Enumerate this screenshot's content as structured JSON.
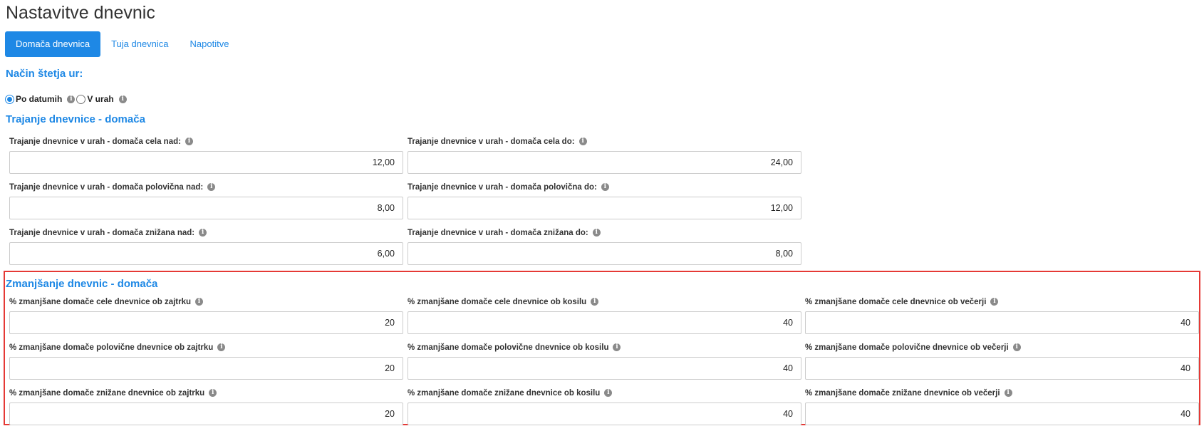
{
  "page_title": "Nastavitve dnevnic",
  "tabs": [
    {
      "label": "Domača dnevnica",
      "active": true
    },
    {
      "label": "Tuja dnevnica",
      "active": false
    },
    {
      "label": "Napotitve",
      "active": false
    }
  ],
  "counting": {
    "title": "Način štetja ur:",
    "options": [
      {
        "label": "Po datumih",
        "checked": true
      },
      {
        "label": "V urah",
        "checked": false
      }
    ]
  },
  "duration": {
    "title": "Trajanje dnevnice - domača",
    "fields": [
      {
        "label": "Trajanje dnevnice v urah - domača cela nad:",
        "value": "12,00"
      },
      {
        "label": "Trajanje dnevnice v urah - domača cela do:",
        "value": "24,00"
      },
      {
        "label": "Trajanje dnevnice v urah - domača polovična nad:",
        "value": "8,00"
      },
      {
        "label": "Trajanje dnevnice v urah - domača polovična do:",
        "value": "12,00"
      },
      {
        "label": "Trajanje dnevnice v urah - domača znižana nad:",
        "value": "6,00"
      },
      {
        "label": "Trajanje dnevnice v urah - domača znižana do:",
        "value": "8,00"
      }
    ]
  },
  "reduction": {
    "title": "Zmanjšanje dnevnic - domača",
    "fields": [
      {
        "label": "% zmanjšane domače cele dnevnice ob zajtrku",
        "value": "20"
      },
      {
        "label": "% zmanjšane domače cele dnevnice ob kosilu",
        "value": "40"
      },
      {
        "label": "% zmanjšane domače cele dnevnice ob večerji",
        "value": "40"
      },
      {
        "label": "% zmanjšane domače polovične dnevnice ob zajtrku",
        "value": "20"
      },
      {
        "label": "% zmanjšane domače polovične dnevnice ob kosilu",
        "value": "40"
      },
      {
        "label": "% zmanjšane domače polovične dnevnice ob večerji",
        "value": "40"
      },
      {
        "label": "% zmanjšane domače znižane dnevnice ob zajtrku",
        "value": "20"
      },
      {
        "label": "% zmanjšane domače znižane dnevnice ob kosilu",
        "value": "40"
      },
      {
        "label": "% zmanjšane domače znižane dnevnice ob večerji",
        "value": "40"
      }
    ]
  },
  "colors": {
    "accent": "#1e88e5",
    "highlight": "#e53935"
  },
  "icons": {
    "info": "info-icon"
  }
}
